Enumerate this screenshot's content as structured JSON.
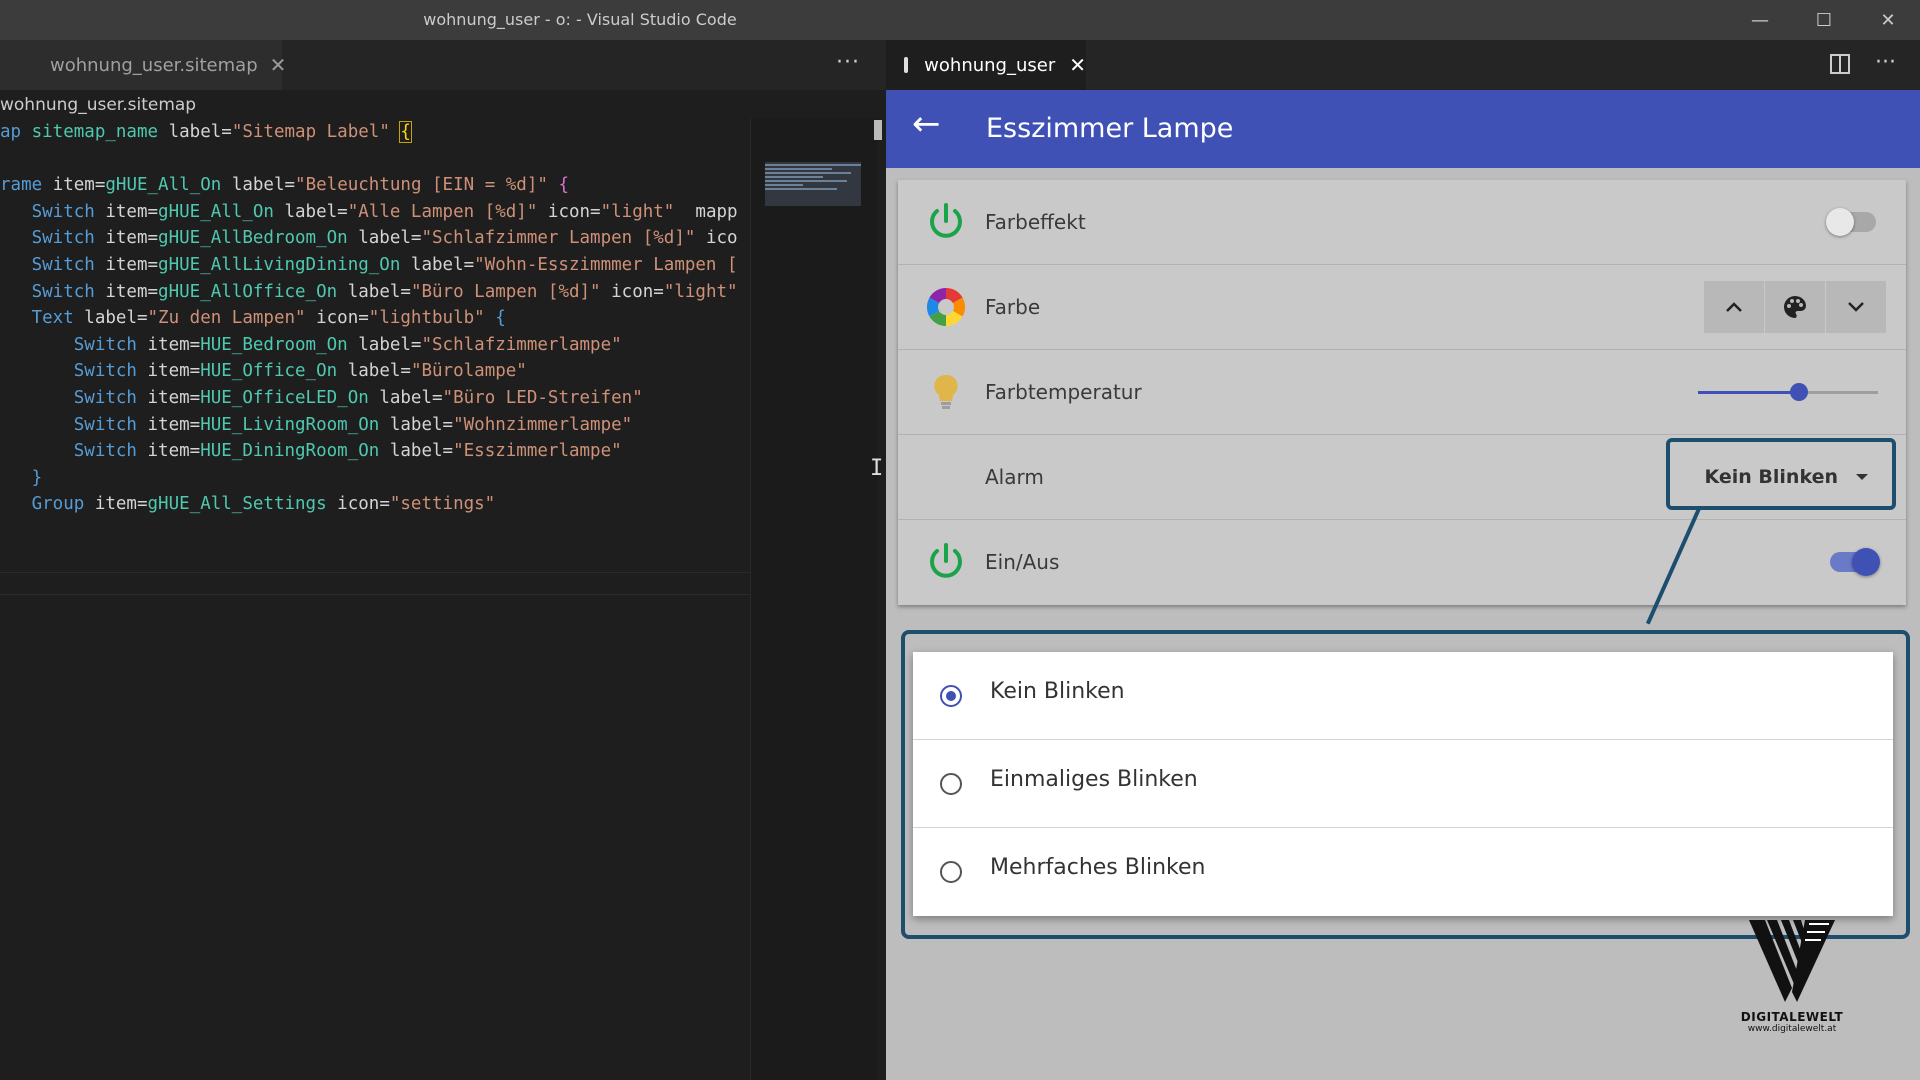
{
  "window": {
    "title": "wohnung_user - o: - Visual Studio Code",
    "min_icon": "minimize-icon",
    "max_icon": "maximize-icon",
    "close_icon": "close-icon"
  },
  "editor": {
    "tab_label": "wohnung_user.sitemap",
    "breadcrumb": "wohnung_user.sitemap",
    "more": "···",
    "lines": [
      [
        {
          "t": "ap ",
          "c": "kw"
        },
        {
          "t": "sitemap_name",
          "c": "it"
        },
        {
          "t": " label=",
          "c": "plain"
        },
        {
          "t": "\"Sitemap Label\"",
          "c": "str"
        },
        {
          "t": " ",
          "c": "plain"
        },
        {
          "t": "{",
          "c": "br cursor"
        }
      ],
      [],
      [
        {
          "t": "rame ",
          "c": "kw"
        },
        {
          "t": "item=",
          "c": "plain"
        },
        {
          "t": "gHUE_All_On",
          "c": "it"
        },
        {
          "t": " label=",
          "c": "plain"
        },
        {
          "t": "\"Beleuchtung [EIN = %d]\"",
          "c": "str"
        },
        {
          "t": " {",
          "c": "brB"
        }
      ],
      [
        {
          "t": "   Switch ",
          "c": "kw"
        },
        {
          "t": "item=",
          "c": "plain"
        },
        {
          "t": "gHUE_All_On",
          "c": "it"
        },
        {
          "t": " label=",
          "c": "plain"
        },
        {
          "t": "\"Alle Lampen [%d]\"",
          "c": "str"
        },
        {
          "t": " icon=",
          "c": "plain"
        },
        {
          "t": "\"light\"",
          "c": "str"
        },
        {
          "t": "  mapp",
          "c": "plain"
        }
      ],
      [
        {
          "t": "   Switch ",
          "c": "kw"
        },
        {
          "t": "item=",
          "c": "plain"
        },
        {
          "t": "gHUE_AllBedroom_On",
          "c": "it"
        },
        {
          "t": " label=",
          "c": "plain"
        },
        {
          "t": "\"Schlafzimmer Lampen [%d]\"",
          "c": "str"
        },
        {
          "t": " ico",
          "c": "plain"
        }
      ],
      [
        {
          "t": "   Switch ",
          "c": "kw"
        },
        {
          "t": "item=",
          "c": "plain"
        },
        {
          "t": "gHUE_AllLivingDining_On",
          "c": "it"
        },
        {
          "t": " label=",
          "c": "plain"
        },
        {
          "t": "\"Wohn-Esszimmmer Lampen [",
          "c": "str"
        }
      ],
      [
        {
          "t": "   Switch ",
          "c": "kw"
        },
        {
          "t": "item=",
          "c": "plain"
        },
        {
          "t": "gHUE_AllOffice_On",
          "c": "it"
        },
        {
          "t": " label=",
          "c": "plain"
        },
        {
          "t": "\"Büro Lampen [%d]\"",
          "c": "str"
        },
        {
          "t": " icon=",
          "c": "plain"
        },
        {
          "t": "\"light\"",
          "c": "str"
        }
      ],
      [
        {
          "t": "   Text ",
          "c": "kw"
        },
        {
          "t": "label=",
          "c": "plain"
        },
        {
          "t": "\"Zu den Lampen\"",
          "c": "str"
        },
        {
          "t": " icon=",
          "c": "plain"
        },
        {
          "t": "\"lightbulb\"",
          "c": "str"
        },
        {
          "t": " {",
          "c": "kw"
        }
      ],
      [
        {
          "t": "       Switch ",
          "c": "kw"
        },
        {
          "t": "item=",
          "c": "plain"
        },
        {
          "t": "HUE_Bedroom_On",
          "c": "it"
        },
        {
          "t": " label=",
          "c": "plain"
        },
        {
          "t": "\"Schlafzimmerlampe\"",
          "c": "str"
        }
      ],
      [
        {
          "t": "       Switch ",
          "c": "kw"
        },
        {
          "t": "item=",
          "c": "plain"
        },
        {
          "t": "HUE_Office_On",
          "c": "it"
        },
        {
          "t": " label=",
          "c": "plain"
        },
        {
          "t": "\"Bürolampe\"",
          "c": "str"
        }
      ],
      [
        {
          "t": "       Switch ",
          "c": "kw"
        },
        {
          "t": "item=",
          "c": "plain"
        },
        {
          "t": "HUE_OfficeLED_On",
          "c": "it"
        },
        {
          "t": " label=",
          "c": "plain"
        },
        {
          "t": "\"Büro LED-Streifen\"",
          "c": "str"
        }
      ],
      [
        {
          "t": "       Switch ",
          "c": "kw"
        },
        {
          "t": "item=",
          "c": "plain"
        },
        {
          "t": "HUE_LivingRoom_On",
          "c": "it"
        },
        {
          "t": " label=",
          "c": "plain"
        },
        {
          "t": "\"Wohnzimmerlampe\"",
          "c": "str"
        }
      ],
      [
        {
          "t": "       Switch ",
          "c": "kw"
        },
        {
          "t": "item=",
          "c": "plain"
        },
        {
          "t": "HUE_DiningRoom_On",
          "c": "it"
        },
        {
          "t": " label=",
          "c": "plain"
        },
        {
          "t": "\"Esszimmerlampe\"",
          "c": "str"
        }
      ],
      [
        {
          "t": "   }",
          "c": "kw"
        }
      ],
      [
        {
          "t": "   Group ",
          "c": "kw"
        },
        {
          "t": "item=",
          "c": "plain"
        },
        {
          "t": "gHUE_All_Settings",
          "c": "it"
        },
        {
          "t": " icon=",
          "c": "plain"
        },
        {
          "t": "\"settings\"",
          "c": "str"
        }
      ]
    ]
  },
  "preview": {
    "tab_label": "wohnung_user",
    "more": "···",
    "appbar": {
      "back_icon": "arrow-left-icon",
      "title": "Esszimmer Lampe"
    },
    "rows": {
      "farbeffekt": {
        "label": "Farbeffekt",
        "icon": "power-icon",
        "state": "off"
      },
      "farbe": {
        "label": "Farbe",
        "icon": "color-wheel-icon",
        "up_icon": "chevron-up-icon",
        "palette_icon": "palette-icon",
        "down_icon": "chevron-down-icon"
      },
      "farbtemperatur": {
        "label": "Farbtemperatur",
        "icon": "lightbulb-icon",
        "level_percent": 56
      },
      "alarm": {
        "label": "Alarm",
        "selected": "Kein Blinken"
      },
      "einaus": {
        "label": "Ein/Aus",
        "icon": "power-icon",
        "state": "on"
      }
    },
    "popup": {
      "options": [
        {
          "label": "Kein Blinken",
          "selected": true
        },
        {
          "label": "Einmaliges Blinken",
          "selected": false
        },
        {
          "label": "Mehrfaches Blinken",
          "selected": false
        }
      ]
    },
    "colors": {
      "accent": "#3f51b5",
      "power_green": "#1aa34a",
      "highlight": "#1d4e6e"
    },
    "logo": {
      "brand": "DIGITALEWELT",
      "url": "www.digitalewelt.at"
    }
  }
}
